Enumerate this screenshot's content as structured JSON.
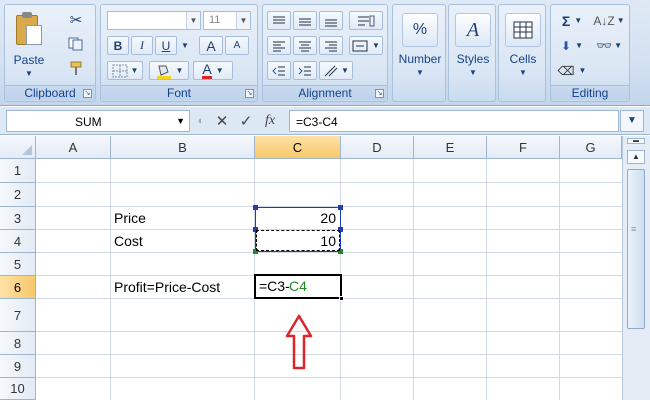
{
  "ribbon": {
    "clipboard": {
      "label": "Clipboard",
      "paste": "Paste"
    },
    "font": {
      "label": "Font",
      "font_name": "",
      "font_size": "11",
      "bold": "B",
      "italic": "I",
      "underline": "U",
      "grow": "A",
      "shrink": "A"
    },
    "alignment": {
      "label": "Alignment"
    },
    "number": {
      "label": "Number",
      "icon_text": "%"
    },
    "styles": {
      "label": "Styles"
    },
    "cells": {
      "label": "Cells"
    },
    "editing": {
      "label": "Editing",
      "sigma": "Σ"
    }
  },
  "formula_bar": {
    "name_box": "SUM",
    "fx": "fx",
    "formula": "=C3-C4"
  },
  "columns": [
    "A",
    "B",
    "C",
    "D",
    "E",
    "F",
    "G"
  ],
  "active_column": "C",
  "rows": [
    "1",
    "2",
    "3",
    "4",
    "5",
    "6",
    "7",
    "8",
    "9",
    "10"
  ],
  "active_row": "6",
  "cells": {
    "B3": "Price",
    "C3": "20",
    "B4": "Cost",
    "C4": "10",
    "B6": "Profit=Price-Cost",
    "C6_part1": "=C3-",
    "C6_part2": "C4"
  },
  "colors": {
    "range_blue": "#1e3cb4",
    "ref_green": "#228b22",
    "arrow_red": "#d9262c"
  }
}
